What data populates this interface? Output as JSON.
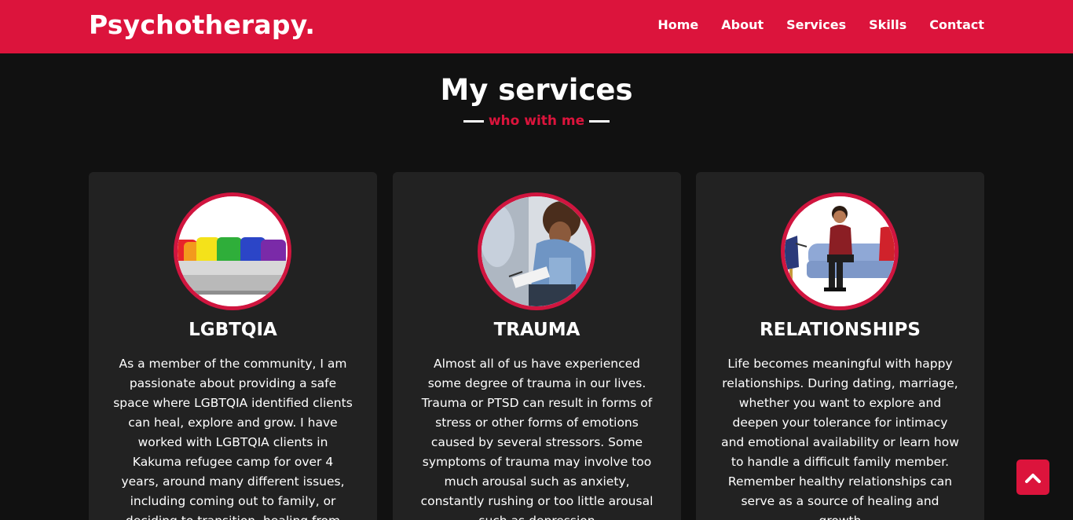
{
  "nav": {
    "logo": "Psychotherapy",
    "logo_dot": ".",
    "links": [
      "Home",
      "About",
      "Services",
      "Skills",
      "Contact"
    ]
  },
  "section": {
    "title": "My services",
    "subtitle": "who with me"
  },
  "cards": [
    {
      "title": "LGBTQIA",
      "text": "As a member of the community, I am passionate about providing a safe space where LGBTQIA identified clients can heal, explore and grow. I have worked with LGBTQIA clients in Kakuma refugee camp for over 4 years, around many different issues, including coming out to family, or deciding to transition, healing from"
    },
    {
      "title": "TRAUMA",
      "text": "Almost all of us have experienced some degree of trauma in our lives. Trauma or PTSD can result in forms of stress or other forms of emotions caused by several stressors. Some symptoms of trauma may involve too much arousal such as anxiety, constantly rushing or too little arousal such as depression"
    },
    {
      "title": "RELATIONSHIPS",
      "text": "Life becomes meaningful with happy relationships. During dating, marriage, whether you want to explore and deepen your tolerance for intimacy and emotional availability or learn how to handle a difficult family member. Remember healthy relationships can serve as a source of healing and growth"
    }
  ],
  "icons": {
    "scroll_top": "chevron-up-icon"
  },
  "colors": {
    "brand": "#dc143c",
    "background": "#111111",
    "card": "#222222"
  }
}
